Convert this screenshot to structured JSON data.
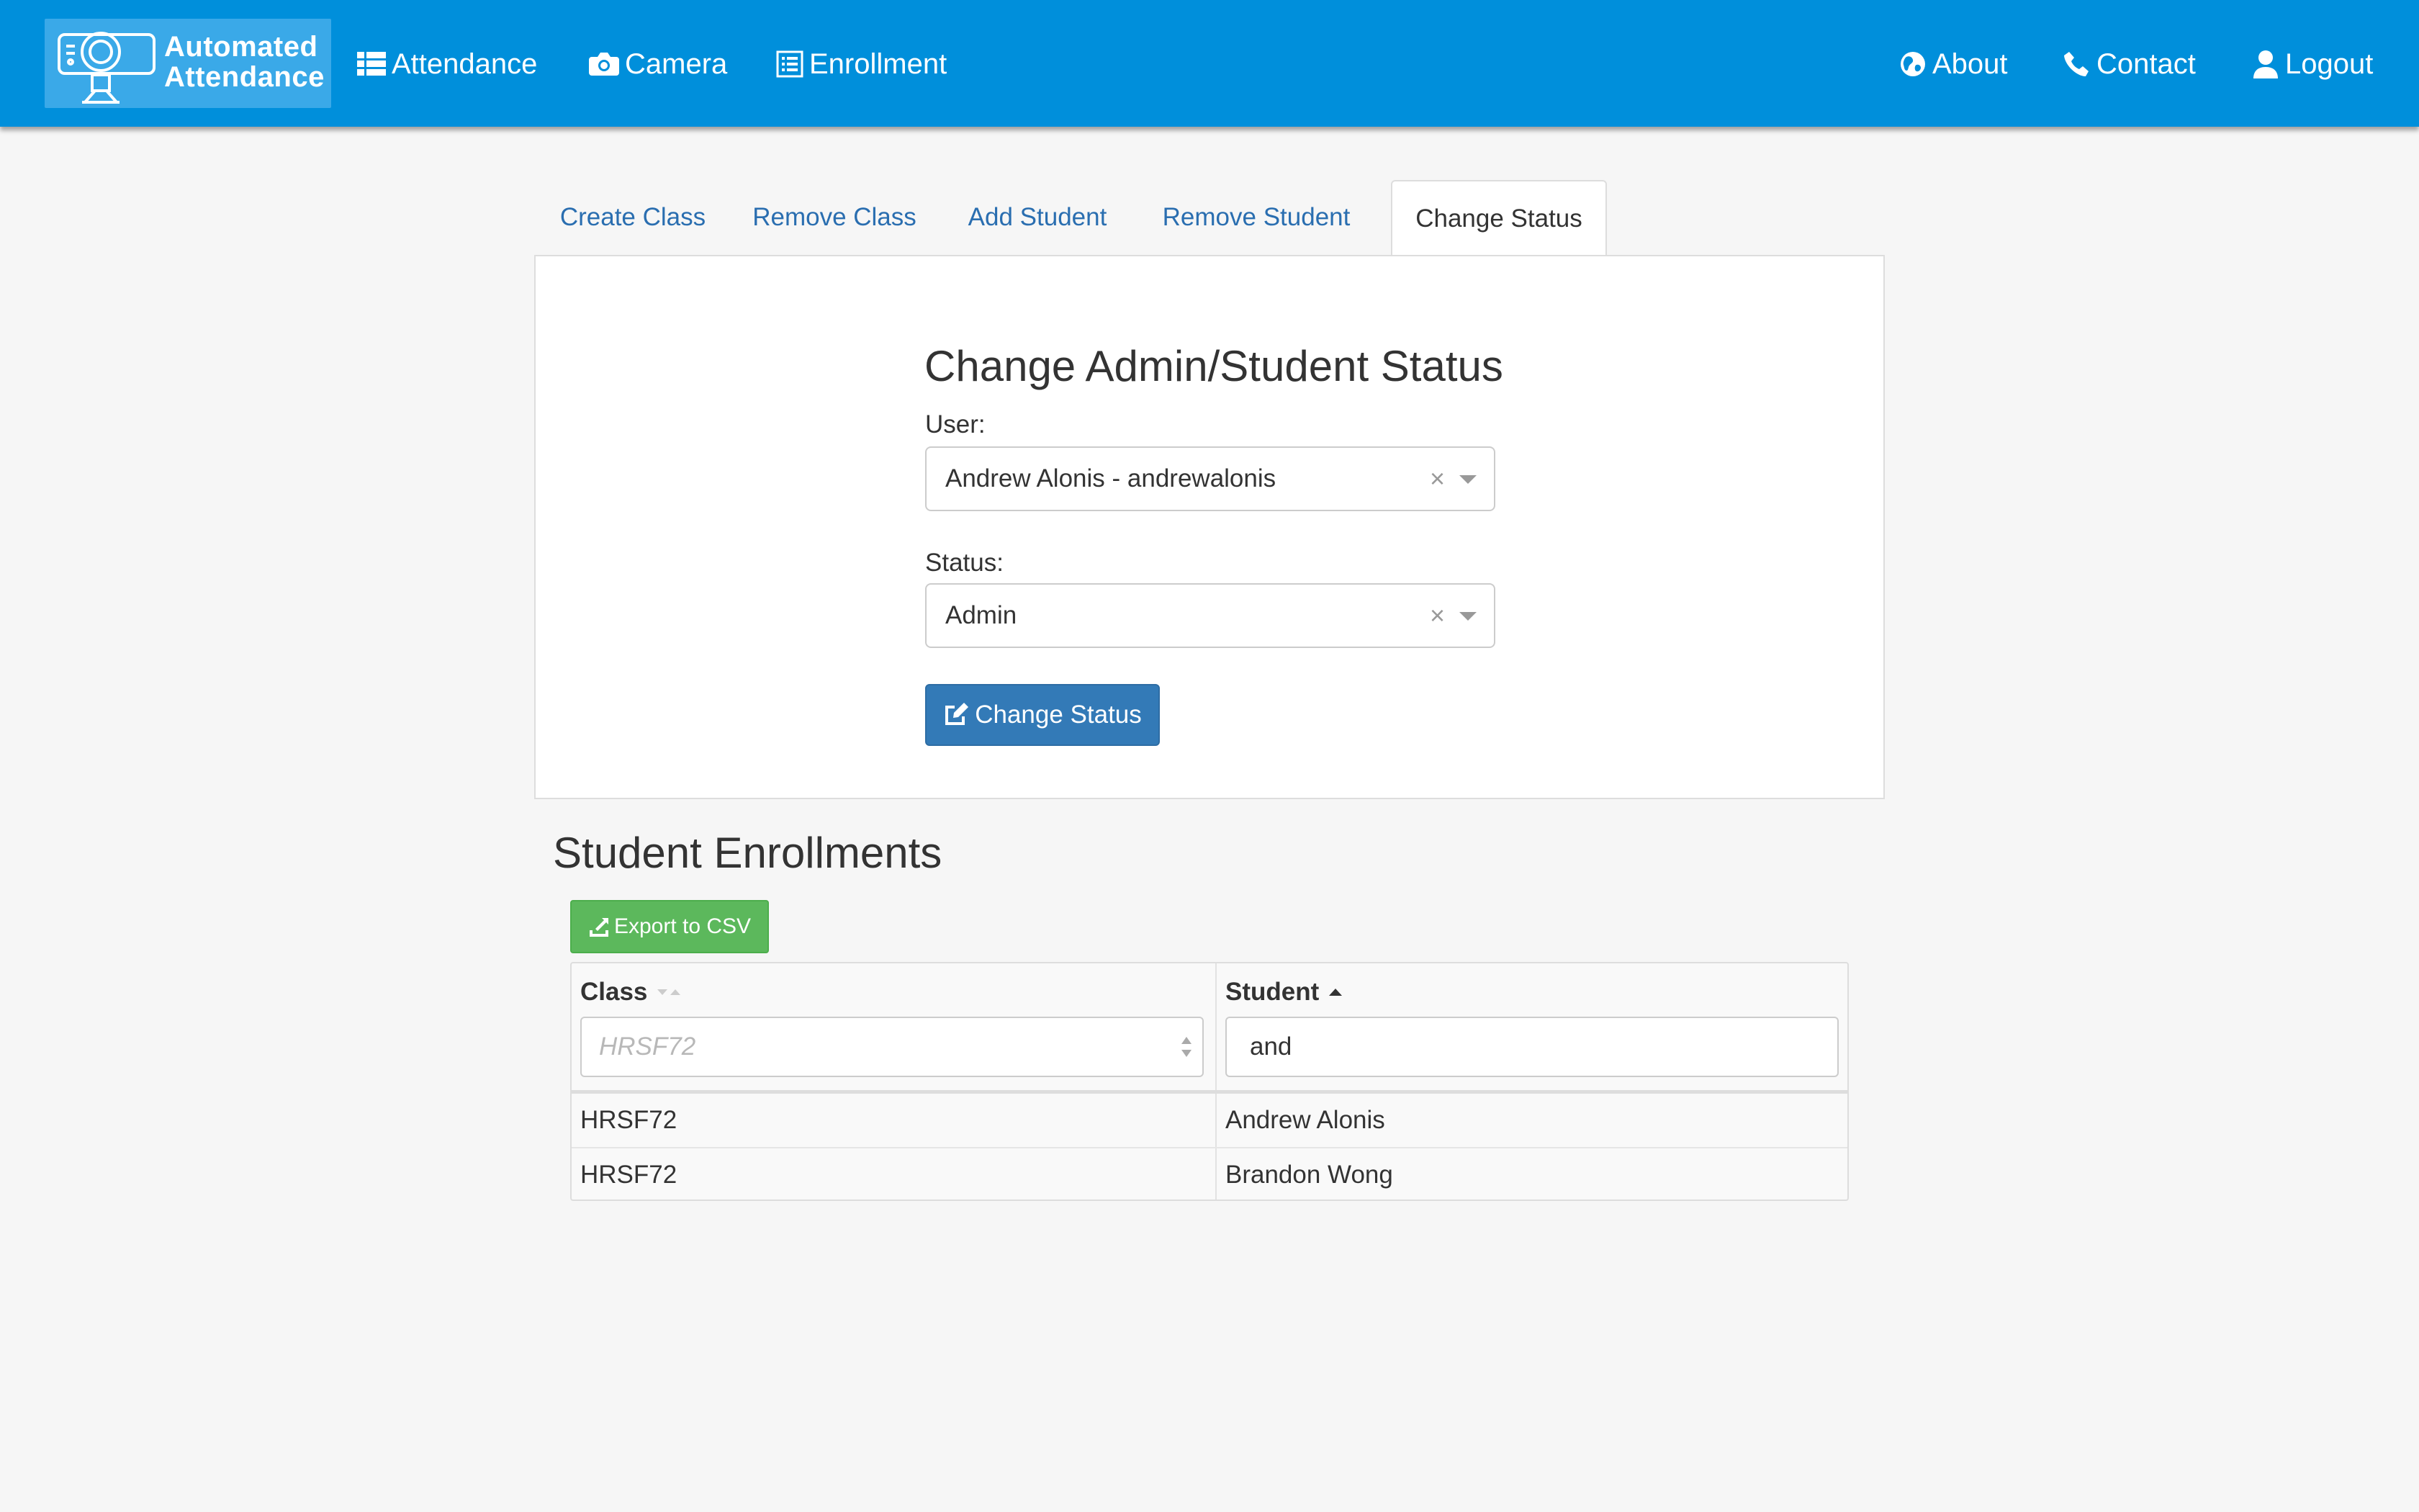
{
  "navbar": {
    "brand": {
      "line1": "Automated",
      "line2": "Attendance"
    },
    "left_items": [
      {
        "label": "Attendance",
        "icon": "list-icon"
      },
      {
        "label": "Camera",
        "icon": "camera-icon"
      },
      {
        "label": "Enrollment",
        "icon": "list-alt-icon"
      }
    ],
    "right_items": [
      {
        "label": "About",
        "icon": "globe-icon"
      },
      {
        "label": "Contact",
        "icon": "phone-icon"
      },
      {
        "label": "Logout",
        "icon": "user-icon"
      }
    ],
    "color": "#008fdb"
  },
  "tabs": [
    {
      "label": "Create Class",
      "active": false
    },
    {
      "label": "Remove Class",
      "active": false
    },
    {
      "label": "Add Student",
      "active": false
    },
    {
      "label": "Remove Student",
      "active": false
    },
    {
      "label": "Change Status",
      "active": true
    }
  ],
  "change_status": {
    "title": "Change Admin/Student Status",
    "user_label": "User:",
    "user_value": "Andrew Alonis - andrewalonis",
    "status_label": "Status:",
    "status_value": "Admin",
    "clear_glyph": "×",
    "submit_label": "Change Status"
  },
  "enrollments": {
    "title": "Student Enrollments",
    "export_label": "Export to CSV",
    "columns": [
      {
        "label": "Class",
        "sort": "none",
        "filter_placeholder": "HRSF72"
      },
      {
        "label": "Student",
        "sort": "ascending",
        "filter_value": "and"
      }
    ],
    "rows": [
      {
        "class": "HRSF72",
        "student": "Andrew Alonis"
      },
      {
        "class": "HRSF72",
        "student": "Brandon Wong"
      }
    ]
  },
  "colors": {
    "primary": "#337ab7",
    "success": "#5cb85c",
    "link": "#2a6eb0",
    "background": "#f6f6f6"
  }
}
